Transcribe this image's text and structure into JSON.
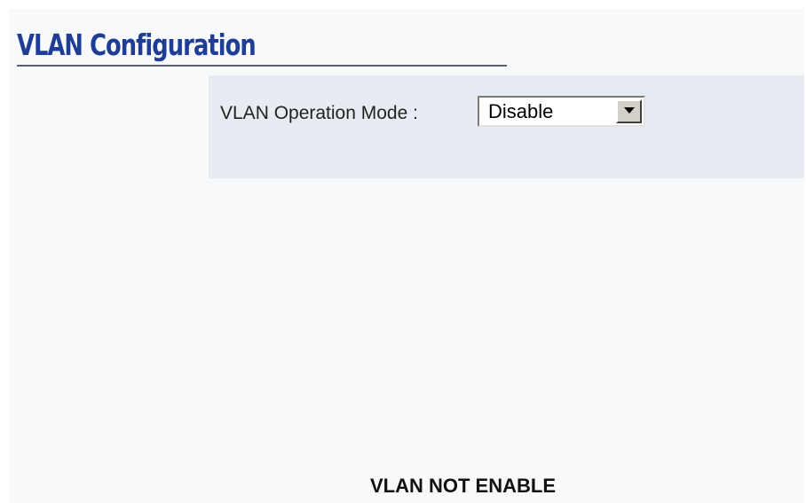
{
  "page": {
    "title": "VLAN Configuration",
    "title_color": "#1f3d94",
    "panel_color": "#e6ecf2"
  },
  "vlan_form": {
    "mode_label": "VLAN Operation Mode :",
    "mode_selected": "Disable",
    "mode_select_icon": "dropdown-arrow-icon"
  },
  "status": {
    "message": "VLAN NOT ENABLE"
  }
}
